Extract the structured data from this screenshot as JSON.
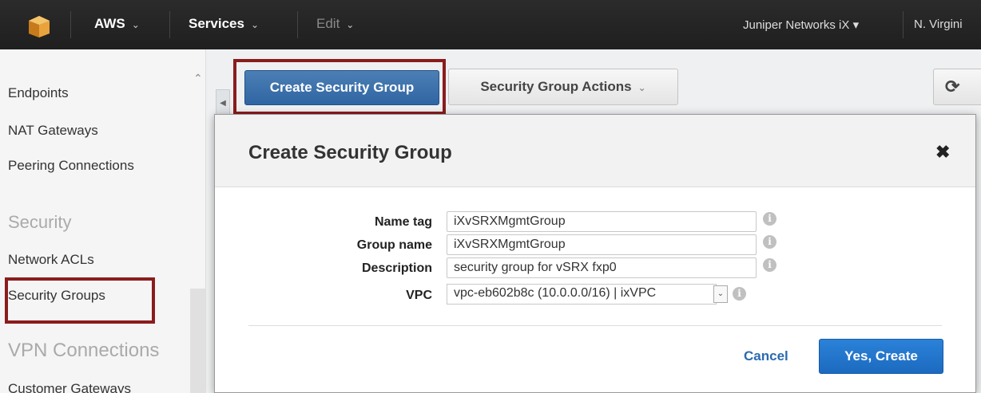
{
  "topbar": {
    "aws_label": "AWS",
    "services_label": "Services",
    "edit_label": "Edit",
    "account_label": "Juniper Networks iX",
    "region_label": "N. Virgini"
  },
  "sidebar": {
    "items": [
      {
        "label": "Endpoints"
      },
      {
        "label": "NAT Gateways"
      },
      {
        "label": "Peering Connections"
      }
    ],
    "security_heading": "Security",
    "security_items": [
      {
        "label": "Network ACLs"
      },
      {
        "label": "Security Groups"
      }
    ],
    "vpn_heading": "VPN Connections",
    "vpn_items": [
      {
        "label": "Customer Gateways"
      }
    ]
  },
  "toolbar": {
    "create_label": "Create Security Group",
    "actions_label": "Security Group Actions"
  },
  "modal": {
    "title": "Create Security Group",
    "fields": {
      "name_tag_label": "Name tag",
      "name_tag_value": "iXvSRXMgmtGroup",
      "group_name_label": "Group name",
      "group_name_value": "iXvSRXMgmtGroup",
      "description_label": "Description",
      "description_value": "security group for vSRX fxp0",
      "vpc_label": "VPC",
      "vpc_value": "vpc-eb602b8c (10.0.0.0/16) | ixVPC"
    },
    "cancel_label": "Cancel",
    "yes_label": "Yes, Create"
  },
  "colors": {
    "highlight_box": "#8b1c1c",
    "primary_button": "#1c6ac0",
    "link": "#2a6ab0"
  }
}
